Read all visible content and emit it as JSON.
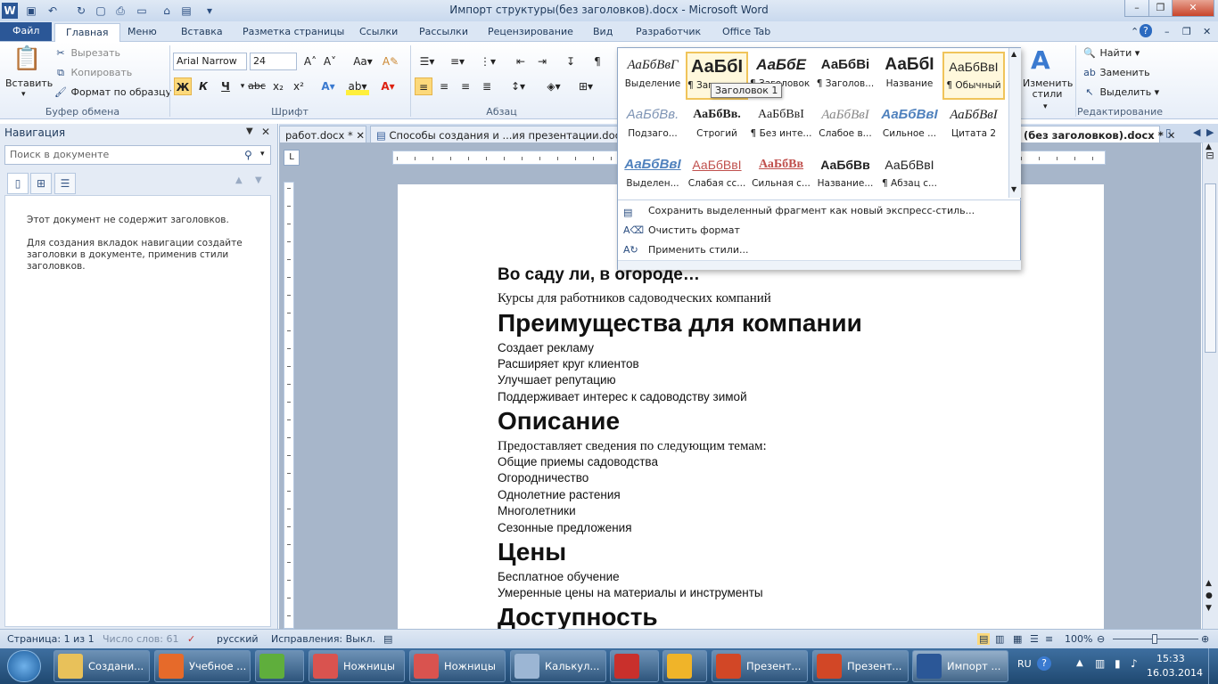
{
  "window": {
    "title": "Импорт структуры(без заголовков).docx - Microsoft Word",
    "app_icon": "word-icon",
    "quick_access": [
      "save-icon",
      "undo-icon",
      "redo-icon",
      "new-icon",
      "print-icon",
      "table-icon",
      "open-icon",
      "folder-icon",
      "customize-icon"
    ],
    "controls": [
      "minimize-icon",
      "maximize-icon",
      "close-icon"
    ]
  },
  "ribbon_tabs": [
    "Файл",
    "Главная",
    "Меню",
    "Вставка",
    "Разметка страницы",
    "Ссылки",
    "Рассылки",
    "Рецензирование",
    "Вид",
    "Разработчик",
    "Office Tab"
  ],
  "ribbon": {
    "clipboard": {
      "paste": "Вставить",
      "cut": "Вырезать",
      "copy": "Копировать",
      "format_painter": "Формат по образцу",
      "label": "Буфер обмена"
    },
    "font": {
      "name": "Arial Narrow",
      "size": "24",
      "bold": "Ж",
      "italic": "К",
      "underline": "Ч",
      "strike": "abc",
      "sub": "x₂",
      "sup": "x²",
      "label": "Шрифт"
    },
    "paragraph": {
      "label": "Абзац"
    },
    "change_styles": "Изменить стили",
    "editing": {
      "find": "Найти",
      "replace": "Заменить",
      "select": "Выделить",
      "label": "Редактирование"
    }
  },
  "gallery": {
    "styles": [
      {
        "preview": "АаБбВвГ",
        "name": "Выделение"
      },
      {
        "preview": "АаБбI",
        "name": "¶ Заголовок 1"
      },
      {
        "preview": "АаБбЕ",
        "name": "¶ Заголовок 2"
      },
      {
        "preview": "АаБбВі",
        "name": "¶ Заголов..."
      },
      {
        "preview": "АаБбІ",
        "name": "Название"
      },
      {
        "preview": "АаБбВвІ",
        "name": "¶ Обычный"
      },
      {
        "preview": "АаБбВв.",
        "name": "Подзаго..."
      },
      {
        "preview": "АаБбВв.",
        "name": "Строгий"
      },
      {
        "preview": "АаБбВвІ",
        "name": "¶ Без инте..."
      },
      {
        "preview": "АаБбВвІ",
        "name": "Слабое в..."
      },
      {
        "preview": "АаБбВвІ",
        "name": "Сильное ..."
      },
      {
        "preview": "АаБбВвІ",
        "name": "Цитата 2"
      },
      {
        "preview": "АаБбВвІ",
        "name": "Выделен..."
      },
      {
        "preview": "АаБбВвІ",
        "name": "Слабая сс..."
      },
      {
        "preview": "АаБбВв",
        "name": "Сильная с..."
      },
      {
        "preview": "АаБбВв",
        "name": "Название..."
      },
      {
        "preview": "АаБбВвІ",
        "name": "¶ Абзац с..."
      }
    ],
    "menu": [
      {
        "label": "Сохранить выделенный фрагмент как новый экспресс-стиль...",
        "icon": "save-style-icon"
      },
      {
        "label": "Очистить формат",
        "icon": "clear-format-icon"
      },
      {
        "label": "Применить стили...",
        "icon": "apply-styles-icon"
      }
    ],
    "tooltip": "Заголовок 1"
  },
  "navigation": {
    "title": "Навигация",
    "search_placeholder": "Поиск в документе",
    "message1": "Этот документ не содержит заголовков.",
    "message2": "Для создания вкладок навигации создайте заголовки в документе, применив стили заголовков."
  },
  "doc_tabs": [
    {
      "label": "работ.docx *",
      "active": false
    },
    {
      "label": "Способы создания и ...ия презентации.docx",
      "active": false
    },
    {
      "label": "(без заголовков).docx *",
      "active": true
    }
  ],
  "document": {
    "lines": [
      {
        "text": "Во саду ли, в огороде…",
        "style": "h0"
      },
      {
        "text": "Курсы для работников садоводческих компаний",
        "style": "serif"
      },
      {
        "text": "Преимущества для компании",
        "style": "h1"
      },
      {
        "text": "Создает рекламу",
        "style": "body"
      },
      {
        "text": "Расширяет круг клиентов",
        "style": "body"
      },
      {
        "text": "Улучшает репутацию",
        "style": "body"
      },
      {
        "text": "Поддерживает интерес к садоводству зимой",
        "style": "body"
      },
      {
        "text": "Описание",
        "style": "h1"
      },
      {
        "text": "Предоставляет сведения по следующим темам:",
        "style": "serif"
      },
      {
        "text": "Общие приемы садоводства",
        "style": "body"
      },
      {
        "text": "Огородничество",
        "style": "body"
      },
      {
        "text": "Однолетние растения",
        "style": "body"
      },
      {
        "text": "Многолетники",
        "style": "body"
      },
      {
        "text": "Сезонные предложения",
        "style": "body"
      },
      {
        "text": "Цены",
        "style": "h1"
      },
      {
        "text": "Бесплатное обучение",
        "style": "body"
      },
      {
        "text": "Умеренные цены на материалы и инструменты",
        "style": "body"
      },
      {
        "text": "Доступность",
        "style": "h1"
      }
    ]
  },
  "status": {
    "page": "Страница: 1 из 1",
    "words": "Число слов: 61",
    "lang": "русский",
    "track": "Исправления: Выкл.",
    "zoom": "100%"
  },
  "taskbar": {
    "items": [
      {
        "label": "Создани...",
        "icon": "folder-icon"
      },
      {
        "label": "Учебное ...",
        "icon": "firefox-icon"
      },
      {
        "label": "",
        "icon": "leaf-icon"
      },
      {
        "label": "Ножницы",
        "icon": "scissors-icon"
      },
      {
        "label": "Ножницы",
        "icon": "scissors-icon"
      },
      {
        "label": "Калькул...",
        "icon": "calculator-icon"
      },
      {
        "label": "",
        "icon": "app-icon"
      },
      {
        "label": "",
        "icon": "seven-icon"
      },
      {
        "label": "Презент...",
        "icon": "powerpoint-icon"
      },
      {
        "label": "Презент...",
        "icon": "powerpoint-icon"
      },
      {
        "label": "Импорт ...",
        "icon": "word-icon"
      }
    ],
    "lang": "RU",
    "time": "15:33",
    "date": "16.03.2014"
  }
}
